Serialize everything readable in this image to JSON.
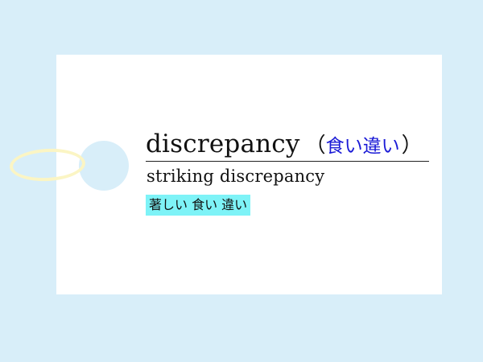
{
  "card": {
    "headword": "discrepancy",
    "paren_open": "（",
    "meaning": "食い違い",
    "paren_close": "）",
    "phrase": "striking discrepancy",
    "phrase_translation": "著しい 食い 違い"
  },
  "colors": {
    "background": "#d8eef9",
    "card": "#ffffff",
    "meaning_text": "#1a1ad6",
    "highlight": "#7ef3f7",
    "string": "#fbf5c4"
  }
}
